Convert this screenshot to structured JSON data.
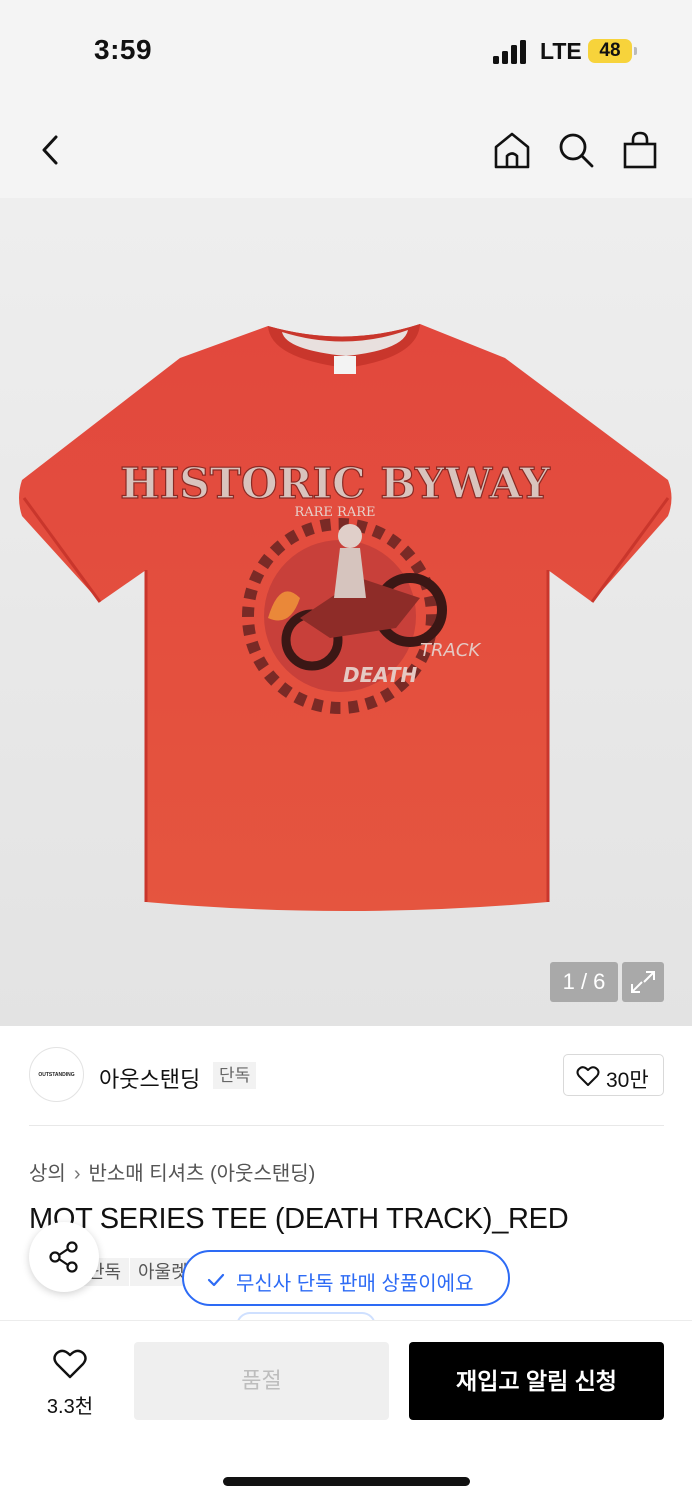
{
  "status_bar": {
    "time": "3:59",
    "network": "LTE",
    "battery": "48"
  },
  "nav": {
    "back_icon": "chevron-left-icon",
    "home_icon": "home-icon",
    "search_icon": "search-icon",
    "cart_icon": "shopping-bag-icon"
  },
  "gallery": {
    "pager": "1 / 6",
    "expand_icon": "expand-icon",
    "shirt_color": "#e2483d",
    "print_text": {
      "headline": "HISTORIC BYWAY",
      "sub": "RARE RARE",
      "track": "TRACK",
      "death": "DEATH"
    }
  },
  "brand": {
    "logo_text": "OUTSTANDING",
    "name": "아웃스탠딩",
    "tag": "단독",
    "like_count": "30만"
  },
  "breadcrumb": {
    "category": "상의",
    "subcategory": "반소매 티셔츠 (아웃스탠딩)"
  },
  "product": {
    "title": "MOT SERIES TEE (DEATH TRACK)_RED"
  },
  "chips": [
    "단독",
    "아울렛"
  ],
  "toast": {
    "text": "무신사 단독 판매 상품이에요"
  },
  "bottom": {
    "wish_count": "3.3천",
    "soldout_label": "품절",
    "restock_label": "재입고 알림 신청"
  },
  "colors": {
    "accent_blue": "#2d6bf5",
    "battery_yellow": "#f7d33b",
    "black": "#000000"
  }
}
